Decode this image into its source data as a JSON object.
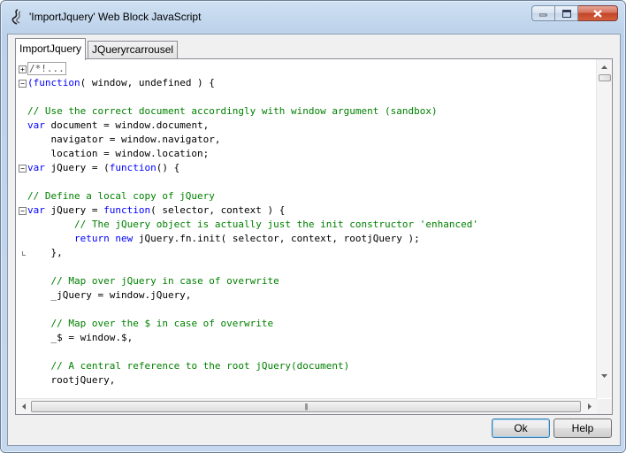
{
  "window": {
    "title": "'ImportJquery' Web Block JavaScript",
    "icon": "swirl-javascript-icon"
  },
  "tabs": [
    {
      "label": "ImportJquery",
      "active": true
    },
    {
      "label": "JQueryrcarrousel",
      "active": false
    }
  ],
  "editor": {
    "lines": [
      {
        "fold": "plus",
        "segments": [
          {
            "t": "/*!...",
            "c": "collapsed"
          }
        ]
      },
      {
        "fold": "minus",
        "segments": [
          {
            "t": "(function",
            "c": "kw"
          },
          {
            "t": "( window, undefined ) {",
            "c": ""
          }
        ]
      },
      {
        "fold": "",
        "segments": []
      },
      {
        "fold": "",
        "segments": [
          {
            "t": "// Use the correct document accordingly with window argument (sandbox)",
            "c": "cm"
          }
        ]
      },
      {
        "fold": "",
        "segments": [
          {
            "t": "var",
            "c": "kw"
          },
          {
            "t": " document = window.document,",
            "c": ""
          }
        ]
      },
      {
        "fold": "",
        "segments": [
          {
            "t": "    navigator = window.navigator,",
            "c": ""
          }
        ]
      },
      {
        "fold": "",
        "segments": [
          {
            "t": "    location = window.location;",
            "c": ""
          }
        ]
      },
      {
        "fold": "minus",
        "segments": [
          {
            "t": "var",
            "c": "kw"
          },
          {
            "t": " jQuery = (",
            "c": ""
          },
          {
            "t": "function",
            "c": "kw"
          },
          {
            "t": "() {",
            "c": ""
          }
        ]
      },
      {
        "fold": "",
        "segments": []
      },
      {
        "fold": "",
        "segments": [
          {
            "t": "// Define a local copy of jQuery",
            "c": "cm"
          }
        ]
      },
      {
        "fold": "minus",
        "segments": [
          {
            "t": "var",
            "c": "kw"
          },
          {
            "t": " jQuery = ",
            "c": ""
          },
          {
            "t": "function",
            "c": "kw"
          },
          {
            "t": "( selector, context ) {",
            "c": ""
          }
        ]
      },
      {
        "fold": "",
        "segments": [
          {
            "t": "        ",
            "c": ""
          },
          {
            "t": "// The jQuery object is actually just the init constructor 'enhanced'",
            "c": "cm"
          }
        ]
      },
      {
        "fold": "",
        "segments": [
          {
            "t": "        ",
            "c": ""
          },
          {
            "t": "return",
            "c": "kw"
          },
          {
            "t": " ",
            "c": ""
          },
          {
            "t": "new",
            "c": "kw"
          },
          {
            "t": " jQuery.fn.init( selector, context, rootjQuery );",
            "c": ""
          }
        ]
      },
      {
        "fold": "end",
        "segments": [
          {
            "t": "    },",
            "c": ""
          }
        ]
      },
      {
        "fold": "",
        "segments": []
      },
      {
        "fold": "",
        "segments": [
          {
            "t": "    ",
            "c": ""
          },
          {
            "t": "// Map over jQuery in case of overwrite",
            "c": "cm"
          }
        ]
      },
      {
        "fold": "",
        "segments": [
          {
            "t": "    _jQuery = window.jQuery,",
            "c": ""
          }
        ]
      },
      {
        "fold": "",
        "segments": []
      },
      {
        "fold": "",
        "segments": [
          {
            "t": "    ",
            "c": ""
          },
          {
            "t": "// Map over the $ in case of overwrite",
            "c": "cm"
          }
        ]
      },
      {
        "fold": "",
        "segments": [
          {
            "t": "    _$ = window.$,",
            "c": ""
          }
        ]
      },
      {
        "fold": "",
        "segments": []
      },
      {
        "fold": "",
        "segments": [
          {
            "t": "    ",
            "c": ""
          },
          {
            "t": "// A central reference to the root jQuery(document)",
            "c": "cm"
          }
        ]
      },
      {
        "fold": "",
        "segments": [
          {
            "t": "    rootjQuery,",
            "c": ""
          }
        ]
      }
    ]
  },
  "buttons": {
    "ok_label": "Ok",
    "help_label": "Help"
  },
  "colors": {
    "keyword": "#0000ff",
    "comment": "#008000",
    "default_button_border": "#3c7fb1"
  }
}
